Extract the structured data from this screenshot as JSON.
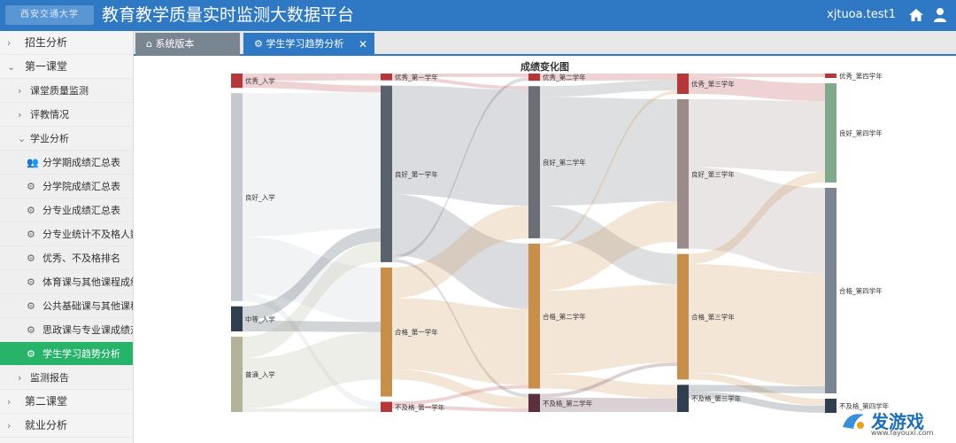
{
  "header": {
    "logo_text": "西安交通大学",
    "title": "教育教学质量实时监测大数据平台",
    "user": "xjtuoa.test1"
  },
  "sidebar": {
    "items": [
      {
        "label": "招生分析",
        "level": 0,
        "chevron": "›"
      },
      {
        "label": "第一课堂",
        "level": 0,
        "chevron": "⌄"
      },
      {
        "label": "课堂质量监测",
        "level": 1,
        "chevron": "›"
      },
      {
        "label": "评教情况",
        "level": 1,
        "chevron": "›"
      },
      {
        "label": "学业分析",
        "level": 1,
        "chevron": "⌄"
      },
      {
        "label": "分学期成绩汇总表",
        "level": 2,
        "icon": "users-icon"
      },
      {
        "label": "分学院成绩汇总表",
        "level": 2,
        "icon": "gear-icon"
      },
      {
        "label": "分专业成绩汇总表",
        "level": 2,
        "icon": "gear-icon"
      },
      {
        "label": "分专业统计不及格人数",
        "level": 2,
        "icon": "gear-icon"
      },
      {
        "label": "优秀、不及格排名",
        "level": 2,
        "icon": "gear-icon"
      },
      {
        "label": "体育课与其他课程成绩",
        "level": 2,
        "icon": "gear-icon"
      },
      {
        "label": "公共基础课与其他课程",
        "level": 2,
        "icon": "gear-icon"
      },
      {
        "label": "思政课与专业课成绩对",
        "level": 2,
        "icon": "gear-icon"
      },
      {
        "label": "学生学习趋势分析",
        "level": 2,
        "icon": "gear-icon",
        "active": true
      },
      {
        "label": "监测报告",
        "level": 1,
        "chevron": "›"
      },
      {
        "label": "第二课堂",
        "level": 0,
        "chevron": "›"
      },
      {
        "label": "就业分析",
        "level": 0,
        "chevron": "›"
      }
    ]
  },
  "tabs": [
    {
      "label": "系统版本",
      "icon": "home-icon"
    },
    {
      "label": "学生学习趋势分析",
      "icon": "gear-icon",
      "close": "✕"
    }
  ],
  "watermark": {
    "text": "发游戏",
    "url": "www.fayouxi.com"
  },
  "chart_data": {
    "type": "sankey",
    "title": "成绩变化图",
    "columns": [
      {
        "stage": "入学",
        "nodes": [
          {
            "name": "优秀_入学",
            "value": 4,
            "color": "#b5373a"
          },
          {
            "name": "良好_入学",
            "value": 58,
            "color": "#c4c9cf"
          },
          {
            "name": "中等_入学",
            "value": 7,
            "color": "#2f3f4f"
          },
          {
            "name": "普通_入学",
            "value": 21,
            "color": "#b2b39a"
          }
        ]
      },
      {
        "stage": "第一学年",
        "nodes": [
          {
            "name": "优秀_第一学年",
            "value": 2,
            "color": "#b5373a"
          },
          {
            "name": "良好_第一学年",
            "value": 52,
            "color": "#59616d"
          },
          {
            "name": "合格_第一学年",
            "value": 38,
            "color": "#c88f4a"
          },
          {
            "name": "不及格_第一学年",
            "value": 3,
            "color": "#b5373a"
          }
        ]
      },
      {
        "stage": "第二学年",
        "nodes": [
          {
            "name": "优秀_第二学年",
            "value": 2,
            "color": "#b5373a"
          },
          {
            "name": "良好_第二学年",
            "value": 42,
            "color": "#6b6f75"
          },
          {
            "name": "合格_第二学年",
            "value": 40,
            "color": "#c88f4a"
          },
          {
            "name": "不及格_第二学年",
            "value": 5,
            "color": "#5a2f3e"
          }
        ]
      },
      {
        "stage": "第三学年",
        "nodes": [
          {
            "name": "优秀_第三学年",
            "value": 6,
            "color": "#b5373a"
          },
          {
            "name": "良好_第三学年",
            "value": 44,
            "color": "#9a8a8a"
          },
          {
            "name": "合格_第三学年",
            "value": 37,
            "color": "#c88f4a"
          },
          {
            "name": "不及格_第三学年",
            "value": 8,
            "color": "#2f3f4f"
          }
        ]
      },
      {
        "stage": "第四学年",
        "nodes": [
          {
            "name": "优秀_第四学年",
            "value": 1,
            "color": "#b5373a"
          },
          {
            "name": "良好_第四学年",
            "value": 28,
            "color": "#7fa98a"
          },
          {
            "name": "合格_第四学年",
            "value": 58,
            "color": "#7a8591"
          },
          {
            "name": "不及格_第四学年",
            "value": 4,
            "color": "#2f3f4f"
          }
        ]
      }
    ],
    "links": [
      [
        0,
        0,
        1,
        0,
        2
      ],
      [
        0,
        0,
        1,
        1,
        2
      ],
      [
        0,
        1,
        1,
        1,
        40
      ],
      [
        0,
        1,
        1,
        2,
        16
      ],
      [
        0,
        1,
        1,
        3,
        2
      ],
      [
        0,
        2,
        1,
        1,
        4
      ],
      [
        0,
        2,
        1,
        2,
        3
      ],
      [
        0,
        3,
        1,
        1,
        6
      ],
      [
        0,
        3,
        1,
        2,
        14
      ],
      [
        0,
        3,
        1,
        3,
        1
      ],
      [
        1,
        0,
        2,
        0,
        1
      ],
      [
        1,
        0,
        2,
        1,
        1
      ],
      [
        1,
        1,
        2,
        1,
        32
      ],
      [
        1,
        1,
        2,
        2,
        18
      ],
      [
        1,
        1,
        2,
        0,
        1
      ],
      [
        1,
        1,
        2,
        3,
        1
      ],
      [
        1,
        2,
        2,
        1,
        9
      ],
      [
        1,
        2,
        2,
        2,
        21
      ],
      [
        1,
        2,
        2,
        3,
        3
      ],
      [
        1,
        3,
        2,
        2,
        1
      ],
      [
        1,
        3,
        2,
        3,
        1
      ],
      [
        2,
        0,
        3,
        0,
        2
      ],
      [
        2,
        1,
        3,
        0,
        3
      ],
      [
        2,
        1,
        3,
        1,
        30
      ],
      [
        2,
        1,
        3,
        2,
        9
      ],
      [
        2,
        2,
        3,
        0,
        1
      ],
      [
        2,
        2,
        3,
        1,
        12
      ],
      [
        2,
        2,
        3,
        2,
        23
      ],
      [
        2,
        2,
        3,
        3,
        4
      ],
      [
        2,
        3,
        3,
        2,
        1
      ],
      [
        2,
        3,
        3,
        3,
        4
      ],
      [
        3,
        0,
        4,
        0,
        1
      ],
      [
        3,
        0,
        4,
        1,
        5
      ],
      [
        3,
        1,
        4,
        1,
        20
      ],
      [
        3,
        1,
        4,
        2,
        24
      ],
      [
        3,
        2,
        4,
        1,
        3
      ],
      [
        3,
        2,
        4,
        2,
        32
      ],
      [
        3,
        2,
        4,
        3,
        2
      ],
      [
        3,
        3,
        4,
        2,
        2
      ],
      [
        3,
        3,
        4,
        3,
        2
      ]
    ]
  }
}
